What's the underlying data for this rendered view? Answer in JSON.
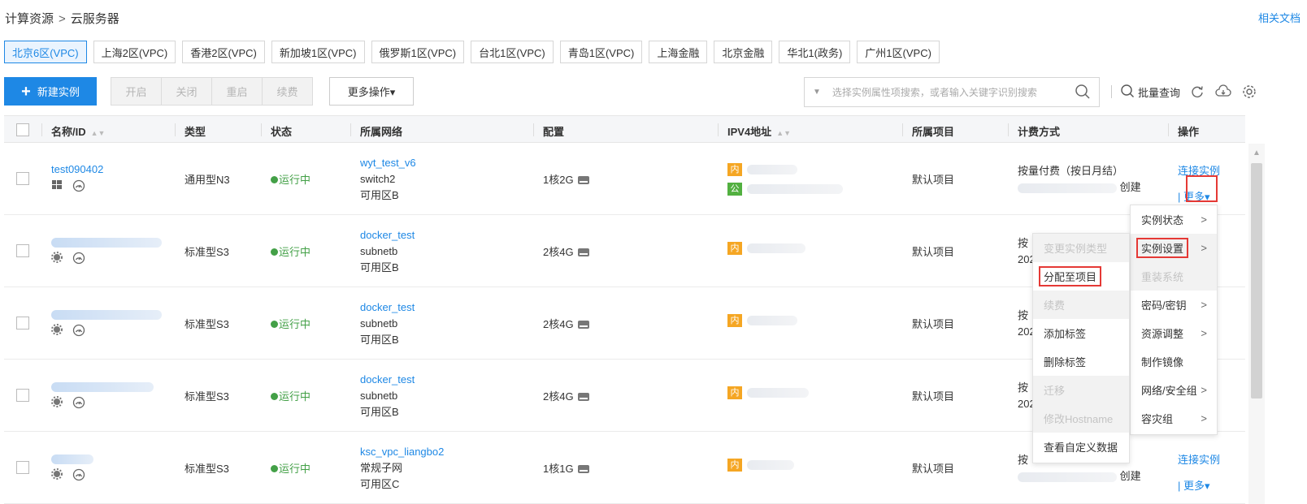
{
  "breadcrumb": {
    "parent": "计算资源",
    "separator": ">",
    "current": "云服务器"
  },
  "doc_link": "相关文档",
  "regions": [
    {
      "label": "北京6区(VPC)",
      "active": true
    },
    {
      "label": "上海2区(VPC)"
    },
    {
      "label": "香港2区(VPC)"
    },
    {
      "label": "新加坡1区(VPC)"
    },
    {
      "label": "俄罗斯1区(VPC)"
    },
    {
      "label": "台北1区(VPC)"
    },
    {
      "label": "青岛1区(VPC)"
    },
    {
      "label": "上海金融"
    },
    {
      "label": "北京金融"
    },
    {
      "label": "华北1(政务)"
    },
    {
      "label": "广州1区(VPC)"
    }
  ],
  "toolbar": {
    "new_instance": "新建实例",
    "start": "开启",
    "stop": "关闭",
    "restart": "重启",
    "renew": "续费",
    "more_ops": "更多操作▾",
    "search_placeholder": "选择实例属性项搜索，或者输入关键字识别搜索",
    "batch_query": "批量查询"
  },
  "columns": {
    "name": "名称/ID",
    "type": "类型",
    "status": "状态",
    "network": "所属网络",
    "config": "配置",
    "ipv4": "IPV4地址",
    "project": "所属项目",
    "billing": "计费方式",
    "actions": "操作"
  },
  "rows": [
    {
      "name": "test090402",
      "type": "通用型N3",
      "status": "运行中",
      "net_name": "wyt_test_v6",
      "subnet": "switch2",
      "zone": "可用区B",
      "config": "1核2G",
      "project": "默认项目",
      "billing": "按量付费（按日月结）",
      "created": "创建",
      "connect": "连接实例",
      "more": "更多"
    },
    {
      "name": "",
      "type": "标准型S3",
      "status": "运行中",
      "net_name": "docker_test",
      "subnet": "subnetb",
      "zone": "可用区B",
      "config": "2核4G",
      "project": "默认项目",
      "billing": "按",
      "billing_tail": "202"
    },
    {
      "name": "",
      "type": "标准型S3",
      "status": "运行中",
      "net_name": "docker_test",
      "subnet": "subnetb",
      "zone": "可用区B",
      "config": "2核4G",
      "project": "默认项目",
      "billing": "按",
      "billing_tail": "202"
    },
    {
      "name": "",
      "type": "标准型S3",
      "status": "运行中",
      "net_name": "docker_test",
      "subnet": "subnetb",
      "zone": "可用区B",
      "config": "2核4G",
      "project": "默认项目",
      "billing": "按",
      "billing_tail": "202"
    },
    {
      "name": "",
      "type": "标准型S3",
      "status": "运行中",
      "net_name": "ksc_vpc_liangbo2",
      "subnet": "常规子网",
      "zone": "可用区C",
      "config": "1核1G",
      "project": "默认项目",
      "billing": "按",
      "created": "创建",
      "connect": "连接实例",
      "more": "更多"
    }
  ],
  "ip_tags": {
    "inner": "内",
    "public": "公"
  },
  "menu_more": [
    {
      "label": "实例状态",
      "arrow": true
    },
    {
      "label": "实例设置",
      "arrow": true,
      "highlight": true
    },
    {
      "label": "重装系统",
      "disabled": true
    },
    {
      "label": "密码/密钥",
      "arrow": true
    },
    {
      "label": "资源调整",
      "arrow": true
    },
    {
      "label": "制作镜像"
    },
    {
      "label": "网络/安全组",
      "arrow": true
    },
    {
      "label": "容灾组",
      "arrow": true
    }
  ],
  "menu_settings": [
    {
      "label": "变更实例类型",
      "disabled": true
    },
    {
      "label": "分配至项目",
      "highlight": true
    },
    {
      "label": "续费",
      "disabled": true
    },
    {
      "label": "添加标签"
    },
    {
      "label": "删除标签"
    },
    {
      "label": "迁移",
      "disabled": true
    },
    {
      "label": "修改Hostname",
      "disabled": true
    },
    {
      "label": "查看自定义数据"
    }
  ],
  "colors": {
    "accent": "#1e88e5",
    "running": "#43a047",
    "tag_inner": "#f5a623",
    "tag_public": "#52b040",
    "highlight_box": "#e53935"
  }
}
